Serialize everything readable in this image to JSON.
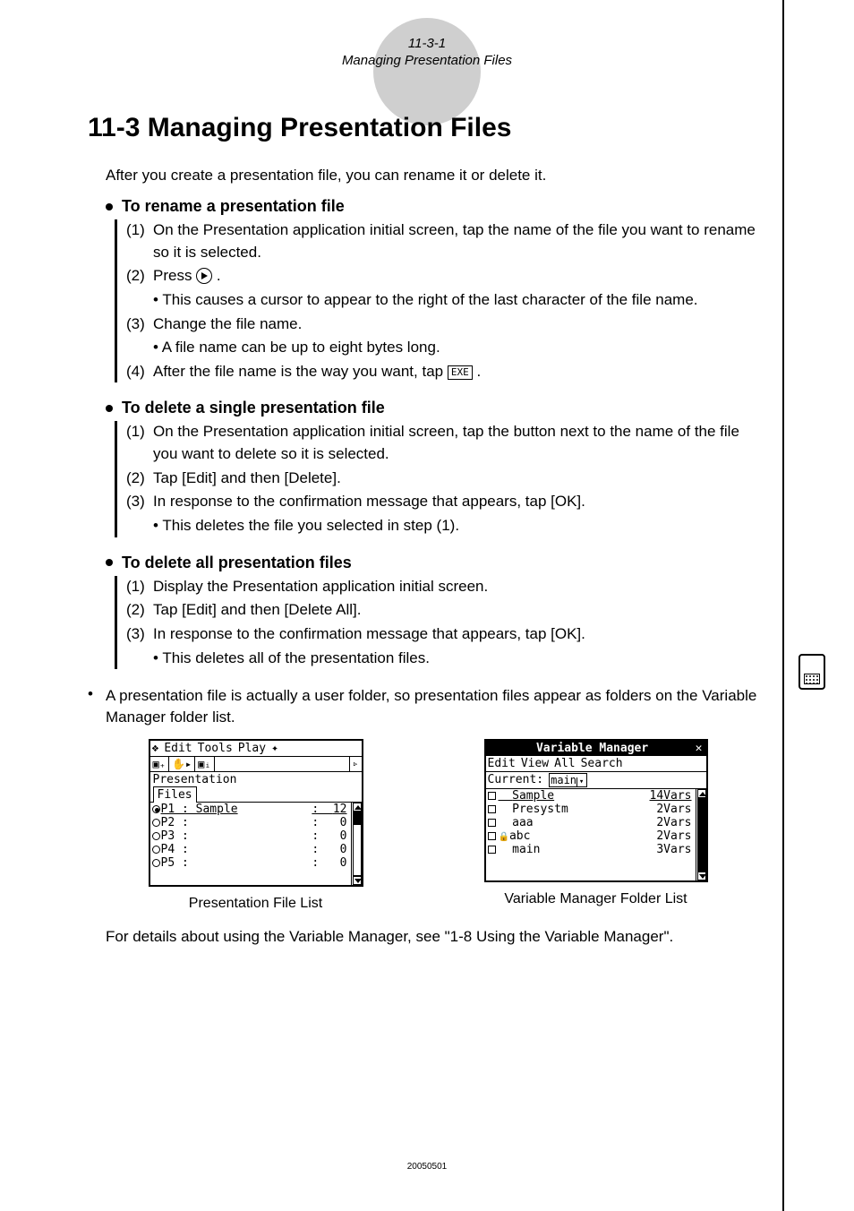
{
  "header": {
    "pagenum": "11-3-1",
    "subtitle": "Managing Presentation Files"
  },
  "title": "11-3 Managing Presentation Files",
  "intro": "After you create a presentation file, you can rename it or delete it.",
  "icons": {
    "exe": "EXE"
  },
  "sections": [
    {
      "title": "To rename a presentation file",
      "steps": [
        {
          "num": "(1)",
          "text": "On the Presentation application initial screen, tap the name of the file you want to rename so it is selected."
        },
        {
          "num": "(2)",
          "text": "Press",
          "sub": "• This causes a cursor to appear to the right of the last character of the file name."
        },
        {
          "num": "(3)",
          "text": "Change the file name.",
          "sub": "• A file name can be up to eight bytes long."
        },
        {
          "num": "(4)",
          "text": "After the file name is the way you want, tap"
        }
      ]
    },
    {
      "title": "To delete a single presentation file",
      "steps": [
        {
          "num": "(1)",
          "text": "On the Presentation application initial screen, tap the button next to the name of the file you want to delete so it is selected."
        },
        {
          "num": "(2)",
          "text": "Tap [Edit] and then [Delete]."
        },
        {
          "num": "(3)",
          "text": "In response to the confirmation message that appears, tap [OK].",
          "sub": "• This deletes the file you selected in step (1)."
        }
      ]
    },
    {
      "title": "To delete all presentation files",
      "steps": [
        {
          "num": "(1)",
          "text": "Display the Presentation application initial screen."
        },
        {
          "num": "(2)",
          "text": "Tap [Edit] and then [Delete All]."
        },
        {
          "num": "(3)",
          "text": "In response to the confirmation message that appears, tap [OK].",
          "sub": "• This deletes all of the presentation files."
        }
      ]
    }
  ],
  "after_note": "A presentation file is actually a user folder, so presentation files appear as folders on the Variable Manager folder list.",
  "fig1": {
    "menu": [
      "Edit",
      "Tools",
      "Play"
    ],
    "tab_top": "Presentation",
    "tab": "Files",
    "rows": [
      {
        "left": "P1 : Sample",
        "right": "12"
      },
      {
        "left": "P2 :",
        "right": "0"
      },
      {
        "left": "P3 :",
        "right": "0"
      },
      {
        "left": "P4 :",
        "right": "0"
      },
      {
        "left": "P5 :",
        "right": "0"
      }
    ],
    "caption": "Presentation File List"
  },
  "fig2": {
    "title": "Variable Manager",
    "close": "✕",
    "menu": [
      "Edit",
      "View",
      "All",
      "Search"
    ],
    "current_label": "Current:",
    "current_value": "main",
    "rows": [
      {
        "left": "Sample",
        "right": "14Vars"
      },
      {
        "left": "Presystm",
        "right": "2Vars"
      },
      {
        "left": "aaa",
        "right": "2Vars"
      },
      {
        "left": "abc",
        "right": "2Vars"
      },
      {
        "left": "main",
        "right": "3Vars"
      }
    ],
    "caption": "Variable Manager Folder List"
  },
  "footer_ref": "For details about using the Variable Manager, see \"1-8 Using the Variable Manager\".",
  "footer_code": "20050501"
}
